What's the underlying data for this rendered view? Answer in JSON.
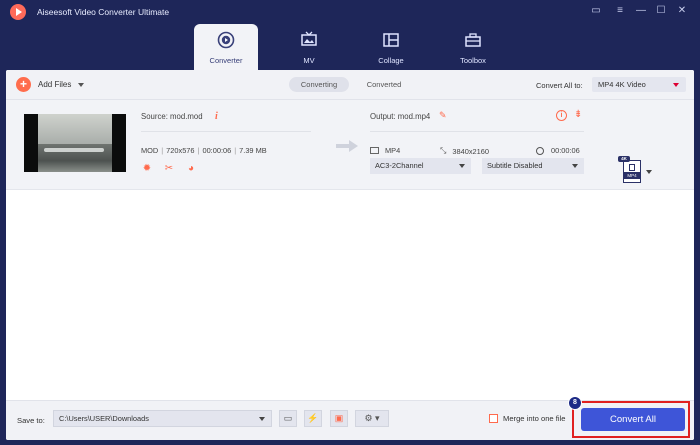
{
  "app": {
    "title": "Aiseesoft Video Converter Ultimate"
  },
  "nav": {
    "tabs": [
      {
        "label": "Converter",
        "icon": "converter-icon",
        "active": true
      },
      {
        "label": "MV",
        "icon": "tv-icon",
        "active": false
      },
      {
        "label": "Collage",
        "icon": "collage-icon",
        "active": false
      },
      {
        "label": "Toolbox",
        "icon": "toolbox-icon",
        "active": false
      }
    ]
  },
  "toolbar": {
    "add_files_label": "Add Files",
    "segments": [
      "Converting",
      "Converted"
    ],
    "convert_all_to_label": "Convert All to:",
    "format_value": "MP4 4K Video"
  },
  "file": {
    "source_label": "Source: mod.mod",
    "format": "MOD",
    "resolution": "720x576",
    "duration": "00:00:06",
    "size": "7.39 MB",
    "output_label": "Output: mod.mp4",
    "output_format": "MP4",
    "output_resolution": "3840x2160",
    "output_duration": "00:00:06",
    "audio_track": "AC3-2Channel",
    "subtitle": "Subtitle Disabled",
    "format_badge": "4K",
    "format_doc_label": "MP4"
  },
  "bottom": {
    "save_to_label": "Save to:",
    "path": "C:\\Users\\USER\\Downloads",
    "merge_label": "Merge into one file",
    "convert_all_label": "Convert All",
    "step_number": "8"
  },
  "colors": {
    "accent": "#ff6a4d",
    "primary_button": "#3e55d8",
    "highlight_border": "#e02020",
    "chrome": "#1e2659"
  }
}
